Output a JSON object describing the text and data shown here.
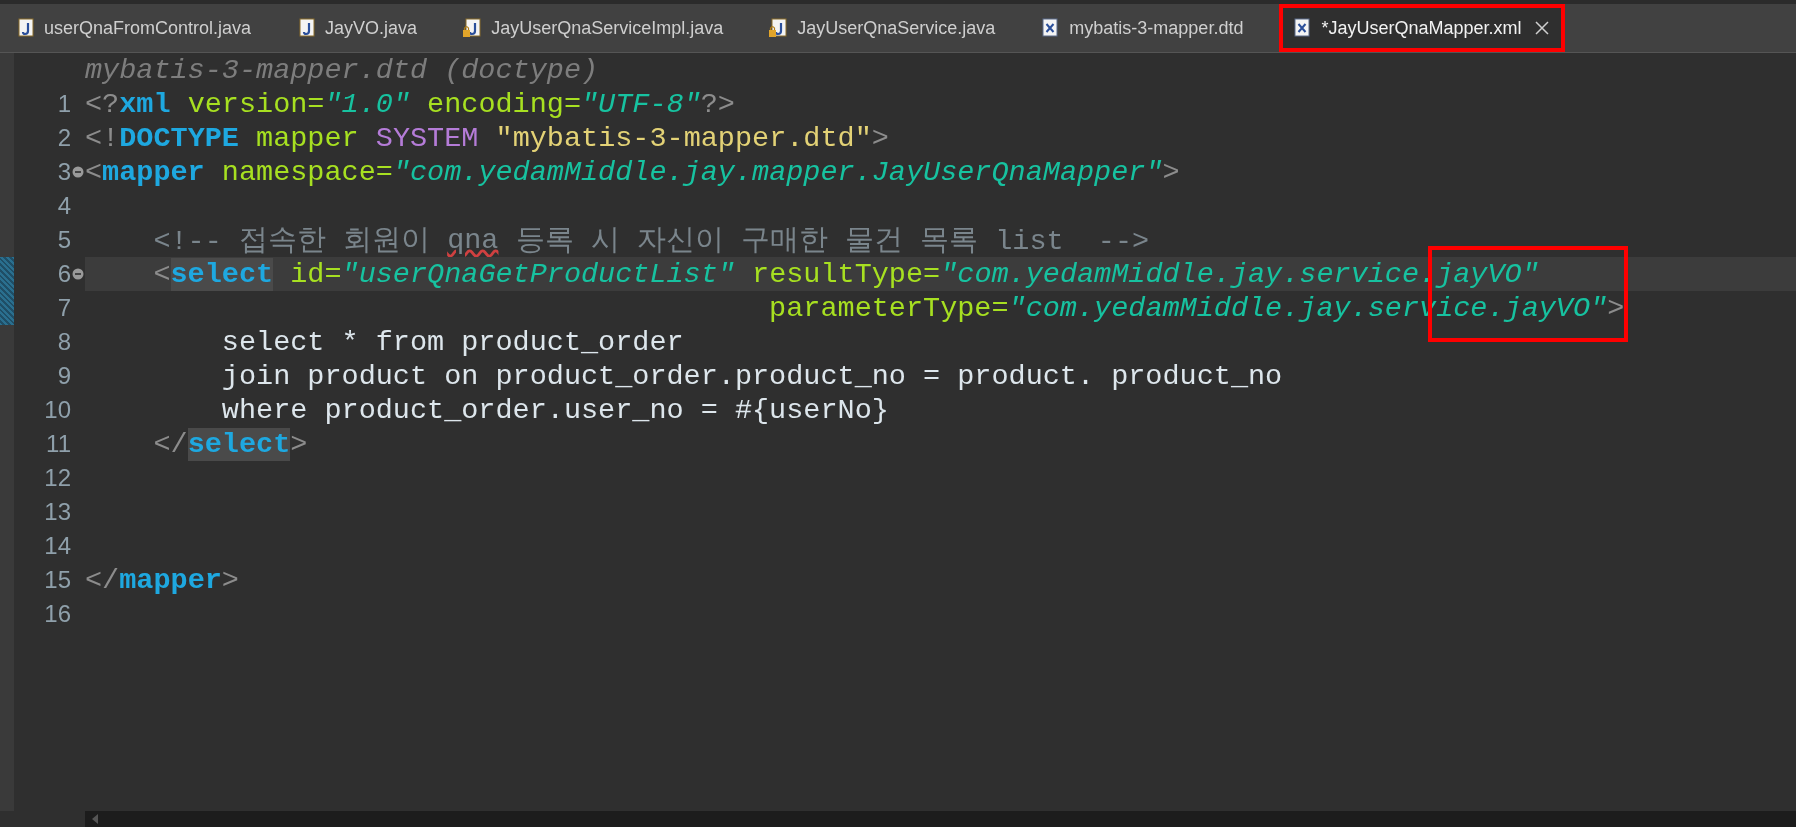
{
  "tabs": [
    {
      "label": "userQnaFromControl.java",
      "kind": "java",
      "selected": false,
      "outlined": false,
      "closable": false
    },
    {
      "label": "JayVO.java",
      "kind": "java",
      "selected": false,
      "outlined": false,
      "closable": false
    },
    {
      "label": "JayUserQnaServiceImpl.java",
      "kind": "java-locked",
      "selected": false,
      "outlined": false,
      "closable": false
    },
    {
      "label": "JayUserQnaService.java",
      "kind": "java-locked",
      "selected": false,
      "outlined": false,
      "closable": false
    },
    {
      "label": "mybatis-3-mapper.dtd",
      "kind": "xml",
      "selected": false,
      "outlined": false,
      "closable": false
    },
    {
      "label": "*JayUserQnaMapper.xml",
      "kind": "xml",
      "selected": true,
      "outlined": true,
      "closable": true
    }
  ],
  "editor": {
    "header": "mybatis-3-mapper.dtd (doctype)",
    "markup_box": true,
    "lines": [
      {
        "number": "1",
        "fold": false,
        "current": false,
        "changed": false,
        "tokens": [
          {
            "kind": "bracket",
            "text": "<?"
          },
          {
            "kind": "tag",
            "text": "xml"
          },
          {
            "kind": "attr",
            "text": " version="
          },
          {
            "kind": "value",
            "text": "\"1.0\""
          },
          {
            "kind": "attr",
            "text": " encoding="
          },
          {
            "kind": "value",
            "text": "\"UTF-8\""
          },
          {
            "kind": "bracket",
            "text": "?>"
          }
        ]
      },
      {
        "number": "2",
        "fold": false,
        "current": false,
        "changed": false,
        "tokens": [
          {
            "kind": "bracket",
            "text": "<!"
          },
          {
            "kind": "tag",
            "text": "DOCTYPE"
          },
          {
            "kind": "attr",
            "text": " mapper"
          },
          {
            "kind": "keyword",
            "text": " SYSTEM"
          },
          {
            "kind": "string",
            "text": " \"mybatis-3-mapper.dtd\""
          },
          {
            "kind": "bracket",
            "text": ">"
          }
        ]
      },
      {
        "number": "3",
        "fold": true,
        "current": false,
        "changed": false,
        "tokens": [
          {
            "kind": "bracket",
            "text": "<"
          },
          {
            "kind": "tag",
            "text": "mapper"
          },
          {
            "kind": "attr",
            "text": " namespace="
          },
          {
            "kind": "value",
            "text": "\"com.yedamMiddle.jay.mapper.JayUserQnaMapper\""
          },
          {
            "kind": "bracket",
            "text": ">"
          }
        ]
      },
      {
        "number": "4",
        "fold": false,
        "current": false,
        "changed": false
      },
      {
        "number": "5",
        "fold": false,
        "current": false,
        "changed": false,
        "tokens": [
          {
            "kind": "comment",
            "text": "    <!-- 접속한 회원이 "
          },
          {
            "kind": "comment-typo",
            "text": "qna"
          },
          {
            "kind": "comment",
            "text": " 등록 시 자신이 구매한 물건 목록 list  -->"
          }
        ]
      },
      {
        "number": "6",
        "fold": true,
        "current": true,
        "changed": true,
        "tokens": [
          {
            "kind": "bracket",
            "text": "    <"
          },
          {
            "kind": "tag-mark",
            "text": "select"
          },
          {
            "kind": "attr",
            "text": " id="
          },
          {
            "kind": "value",
            "text": "\"userQnaGetProductList\""
          },
          {
            "kind": "attr",
            "text": " resultType="
          },
          {
            "kind": "value",
            "text": "\"com.yedamMiddle.jay.service.jayVO\""
          }
        ]
      },
      {
        "number": "7",
        "fold": false,
        "current": false,
        "changed": true,
        "tokens": [
          {
            "kind": "attr",
            "text": "                                        parameterType="
          },
          {
            "kind": "value",
            "text": "\"com.yedamMiddle.jay.service.jayVO\""
          },
          {
            "kind": "bracket",
            "text": ">"
          }
        ]
      },
      {
        "number": "8",
        "fold": false,
        "current": false,
        "changed": false,
        "tokens": [
          {
            "kind": "text",
            "text": "        select * from product_order"
          }
        ]
      },
      {
        "number": "9",
        "fold": false,
        "current": false,
        "changed": false,
        "tokens": [
          {
            "kind": "text",
            "text": "        join product on product_order.product_no = product. product_no"
          }
        ]
      },
      {
        "number": "10",
        "fold": false,
        "current": false,
        "changed": false,
        "tokens": [
          {
            "kind": "text",
            "text": "        where product_order.user_no = #{userNo}"
          }
        ]
      },
      {
        "number": "11",
        "fold": false,
        "current": false,
        "changed": false,
        "tokens": [
          {
            "kind": "bracket",
            "text": "    </"
          },
          {
            "kind": "tag-mark",
            "text": "select"
          },
          {
            "kind": "bracket",
            "text": ">"
          }
        ]
      },
      {
        "number": "12",
        "fold": false,
        "current": false,
        "changed": false
      },
      {
        "number": "13",
        "fold": false,
        "current": false,
        "changed": false
      },
      {
        "number": "14",
        "fold": false,
        "current": false,
        "changed": false
      },
      {
        "number": "15",
        "fold": false,
        "current": false,
        "changed": false,
        "tokens": [
          {
            "kind": "bracket",
            "text": "</"
          },
          {
            "kind": "tag",
            "text": "mapper"
          },
          {
            "kind": "bracket",
            "text": ">"
          }
        ]
      },
      {
        "number": "16",
        "fold": false,
        "current": false,
        "changed": false
      }
    ]
  }
}
